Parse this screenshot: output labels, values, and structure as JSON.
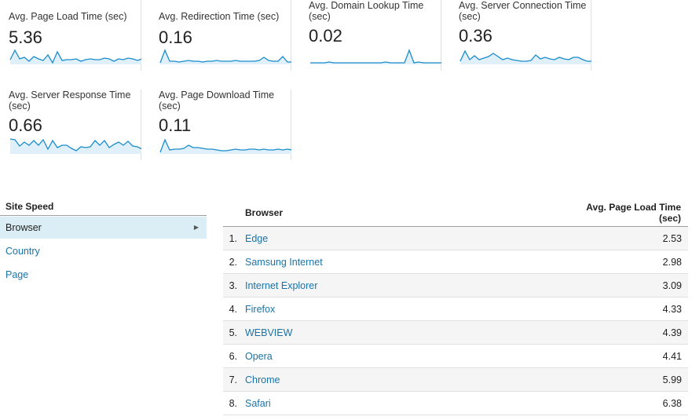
{
  "metrics": [
    {
      "title": "Avg. Page Load Time (sec)",
      "value": "5.36",
      "spark": [
        0.3,
        0.9,
        0.35,
        0.45,
        0.2,
        0.5,
        0.35,
        0.25,
        0.6,
        0.1,
        0.8,
        0.25,
        0.3,
        0.3,
        0.35,
        0.2,
        0.3,
        0.35,
        0.3,
        0.3,
        0.4,
        0.35,
        0.2,
        0.35,
        0.3,
        0.4,
        0.35,
        0.25,
        0.35
      ]
    },
    {
      "title": "Avg. Redirection Time (sec)",
      "value": "0.16",
      "spark": [
        0.1,
        0.9,
        0.2,
        0.2,
        0.15,
        0.2,
        0.25,
        0.2,
        0.2,
        0.15,
        0.2,
        0.2,
        0.25,
        0.2,
        0.2,
        0.2,
        0.25,
        0.2,
        0.2,
        0.2,
        0.2,
        0.25,
        0.45,
        0.25,
        0.2,
        0.2,
        0.5,
        0.15,
        0.15
      ]
    },
    {
      "title": "Avg. Domain Lookup Time (sec)",
      "value": "0.02",
      "spark": [
        0.1,
        0.1,
        0.1,
        0.1,
        0.15,
        0.1,
        0.1,
        0.1,
        0.1,
        0.1,
        0.1,
        0.1,
        0.1,
        0.1,
        0.1,
        0.1,
        0.15,
        0.1,
        0.1,
        0.1,
        0.1,
        0.9,
        0.1,
        0.15,
        0.1,
        0.1,
        0.1,
        0.1,
        0.1
      ]
    },
    {
      "title": "Avg. Server Connection Time (sec)",
      "value": "0.36",
      "spark": [
        0.2,
        0.85,
        0.3,
        0.55,
        0.3,
        0.4,
        0.5,
        0.7,
        0.5,
        0.3,
        0.4,
        0.3,
        0.25,
        0.2,
        0.2,
        0.25,
        0.6,
        0.35,
        0.45,
        0.35,
        0.3,
        0.45,
        0.35,
        0.3,
        0.45,
        0.45,
        0.3,
        0.2,
        0.2
      ]
    },
    {
      "title": "Avg. Server Response Time (sec)",
      "value": "0.66",
      "spark": [
        0.95,
        0.9,
        0.5,
        0.75,
        0.55,
        0.85,
        0.55,
        0.9,
        0.3,
        0.85,
        0.4,
        0.55,
        0.55,
        0.35,
        0.2,
        0.45,
        0.4,
        0.45,
        0.85,
        0.55,
        0.85,
        0.4,
        0.6,
        0.75,
        0.55,
        0.8,
        0.5,
        0.45,
        0.3
      ]
    },
    {
      "title": "Avg. Page Download Time (sec)",
      "value": "0.11",
      "spark": [
        0.1,
        0.9,
        0.25,
        0.3,
        0.3,
        0.35,
        0.55,
        0.4,
        0.4,
        0.35,
        0.3,
        0.3,
        0.25,
        0.2,
        0.2,
        0.25,
        0.3,
        0.25,
        0.25,
        0.3,
        0.3,
        0.25,
        0.3,
        0.25,
        0.25,
        0.3,
        0.25,
        0.3,
        0.25
      ]
    }
  ],
  "sidebar": {
    "title": "Site Speed",
    "items": [
      {
        "label": "Browser",
        "active": true
      },
      {
        "label": "Country",
        "active": false
      },
      {
        "label": "Page",
        "active": false
      }
    ]
  },
  "table": {
    "col_browser": "Browser",
    "col_metric_line1": "Avg. Page Load Time",
    "col_metric_line2": "(sec)",
    "rows": [
      {
        "num": "1.",
        "name": "Edge",
        "value": "2.53"
      },
      {
        "num": "2.",
        "name": "Samsung Internet",
        "value": "2.98"
      },
      {
        "num": "3.",
        "name": "Internet Explorer",
        "value": "3.09"
      },
      {
        "num": "4.",
        "name": "Firefox",
        "value": "4.33"
      },
      {
        "num": "5.",
        "name": "WEBVIEW",
        "value": "4.39"
      },
      {
        "num": "6.",
        "name": "Opera",
        "value": "4.41"
      },
      {
        "num": "7.",
        "name": "Chrome",
        "value": "5.99"
      },
      {
        "num": "8.",
        "name": "Safari",
        "value": "6.38"
      }
    ]
  },
  "colors": {
    "spark_line": "#1a8ccc",
    "spark_fill": "#dff0fa",
    "link": "#1a73a8",
    "active_bg": "#dbeef6"
  }
}
